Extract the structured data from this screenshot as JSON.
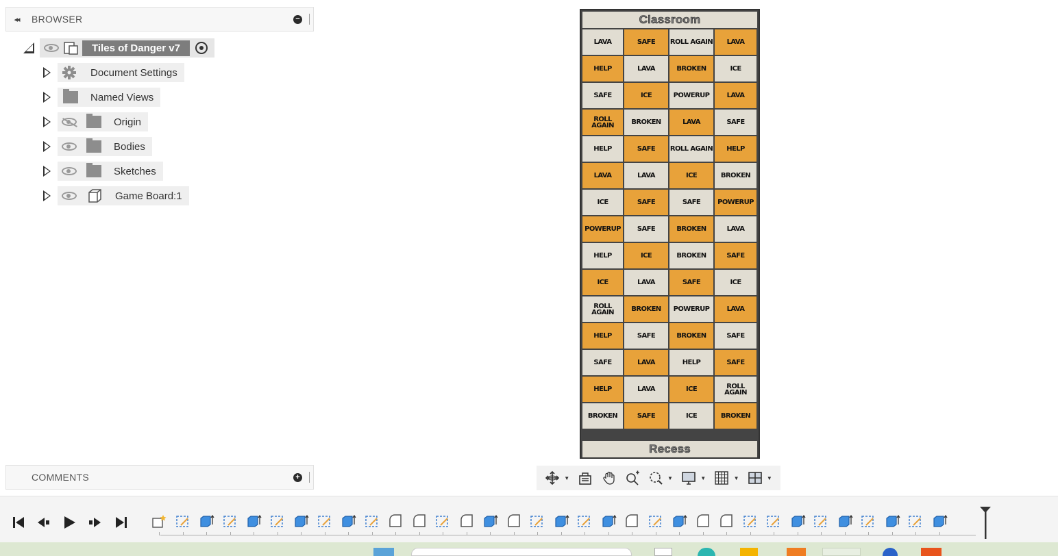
{
  "browser": {
    "collapse_glyph": "◂◂",
    "title": "BROWSER",
    "root": {
      "label": "Tiles of Danger v7"
    },
    "items": [
      {
        "label": "Document Settings",
        "icon": "gear-icon"
      },
      {
        "label": "Named Views",
        "icon": "folder-icon"
      },
      {
        "label": "Origin",
        "icon": "folder-icon",
        "visibility": "hidden"
      },
      {
        "label": "Bodies",
        "icon": "folder-icon",
        "visibility": "visible"
      },
      {
        "label": "Sketches",
        "icon": "folder-icon",
        "visibility": "visible"
      },
      {
        "label": "Game Board:1",
        "icon": "body-icon",
        "visibility": "visible"
      }
    ]
  },
  "comments": {
    "title": "COMMENTS",
    "add_glyph": "+"
  },
  "board": {
    "top_label": "Classroom",
    "bottom_label": "Recess",
    "colors": {
      "orange": "#e8a23a",
      "beige": "#e1ddd2",
      "grid": "#444444"
    },
    "rows": [
      [
        {
          "t": "LAVA",
          "c": "beige"
        },
        {
          "t": "SAFE",
          "c": "orange"
        },
        {
          "t": "ROLL AGAIN",
          "c": "beige"
        },
        {
          "t": "LAVA",
          "c": "orange"
        }
      ],
      [
        {
          "t": "HELP",
          "c": "orange"
        },
        {
          "t": "LAVA",
          "c": "beige"
        },
        {
          "t": "BROKEN",
          "c": "orange"
        },
        {
          "t": "ICE",
          "c": "beige"
        }
      ],
      [
        {
          "t": "SAFE",
          "c": "beige"
        },
        {
          "t": "ICE",
          "c": "orange"
        },
        {
          "t": "POWERUP",
          "c": "beige"
        },
        {
          "t": "LAVA",
          "c": "orange"
        }
      ],
      [
        {
          "t": "ROLL\nAGAIN",
          "c": "orange"
        },
        {
          "t": "BROKEN",
          "c": "beige"
        },
        {
          "t": "LAVA",
          "c": "orange"
        },
        {
          "t": "SAFE",
          "c": "beige"
        }
      ],
      [
        {
          "t": "HELP",
          "c": "beige"
        },
        {
          "t": "SAFE",
          "c": "orange"
        },
        {
          "t": "ROLL AGAIN",
          "c": "beige"
        },
        {
          "t": "HELP",
          "c": "orange"
        }
      ],
      [
        {
          "t": "LAVA",
          "c": "orange"
        },
        {
          "t": "LAVA",
          "c": "beige"
        },
        {
          "t": "ICE",
          "c": "orange"
        },
        {
          "t": "BROKEN",
          "c": "beige"
        }
      ],
      [
        {
          "t": "ICE",
          "c": "beige"
        },
        {
          "t": "SAFE",
          "c": "orange"
        },
        {
          "t": "SAFE",
          "c": "beige"
        },
        {
          "t": "POWERUP",
          "c": "orange"
        }
      ],
      [
        {
          "t": "POWERUP",
          "c": "orange"
        },
        {
          "t": "SAFE",
          "c": "beige"
        },
        {
          "t": "BROKEN",
          "c": "orange"
        },
        {
          "t": "LAVA",
          "c": "beige"
        }
      ],
      [
        {
          "t": "HELP",
          "c": "beige"
        },
        {
          "t": "ICE",
          "c": "orange"
        },
        {
          "t": "BROKEN",
          "c": "beige"
        },
        {
          "t": "SAFE",
          "c": "orange"
        }
      ],
      [
        {
          "t": "ICE",
          "c": "orange"
        },
        {
          "t": "LAVA",
          "c": "beige"
        },
        {
          "t": "SAFE",
          "c": "orange"
        },
        {
          "t": "ICE",
          "c": "beige"
        }
      ],
      [
        {
          "t": "ROLL\nAGAIN",
          "c": "beige"
        },
        {
          "t": "BROKEN",
          "c": "orange"
        },
        {
          "t": "POWERUP",
          "c": "beige"
        },
        {
          "t": "LAVA",
          "c": "orange"
        }
      ],
      [
        {
          "t": "HELP",
          "c": "orange"
        },
        {
          "t": "SAFE",
          "c": "beige"
        },
        {
          "t": "BROKEN",
          "c": "orange"
        },
        {
          "t": "SAFE",
          "c": "beige"
        }
      ],
      [
        {
          "t": "SAFE",
          "c": "beige"
        },
        {
          "t": "LAVA",
          "c": "orange"
        },
        {
          "t": "HELP",
          "c": "beige"
        },
        {
          "t": "SAFE",
          "c": "orange"
        }
      ],
      [
        {
          "t": "HELP",
          "c": "orange"
        },
        {
          "t": "LAVA",
          "c": "beige"
        },
        {
          "t": "ICE",
          "c": "orange"
        },
        {
          "t": "ROLL\nAGAIN",
          "c": "beige"
        }
      ],
      [
        {
          "t": "BROKEN",
          "c": "beige"
        },
        {
          "t": "SAFE",
          "c": "orange"
        },
        {
          "t": "ICE",
          "c": "beige"
        },
        {
          "t": "BROKEN",
          "c": "orange"
        }
      ]
    ]
  },
  "navbar": {
    "tools": [
      "orbit-icon",
      "look-at-icon",
      "pan-hand-icon",
      "zoom-icon",
      "fit-window-icon",
      "display-settings-icon",
      "grid-snap-icon",
      "viewports-icon"
    ]
  },
  "timeline": {
    "playback": [
      "go-to-start-icon",
      "step-back-icon",
      "play-icon",
      "step-forward-icon",
      "go-to-end-icon"
    ],
    "features": [
      "new-component",
      "sketch",
      "extrude",
      "sketch",
      "extrude",
      "sketch",
      "extrude",
      "sketch",
      "extrude",
      "sketch",
      "fillet",
      "fillet",
      "sketch",
      "fillet",
      "extrude",
      "fillet",
      "sketch",
      "extrude",
      "sketch",
      "extrude",
      "fillet",
      "sketch",
      "extrude",
      "fillet",
      "fillet",
      "sketch",
      "sketch",
      "extrude",
      "sketch",
      "extrude",
      "sketch",
      "extrude",
      "sketch",
      "extrude"
    ]
  }
}
